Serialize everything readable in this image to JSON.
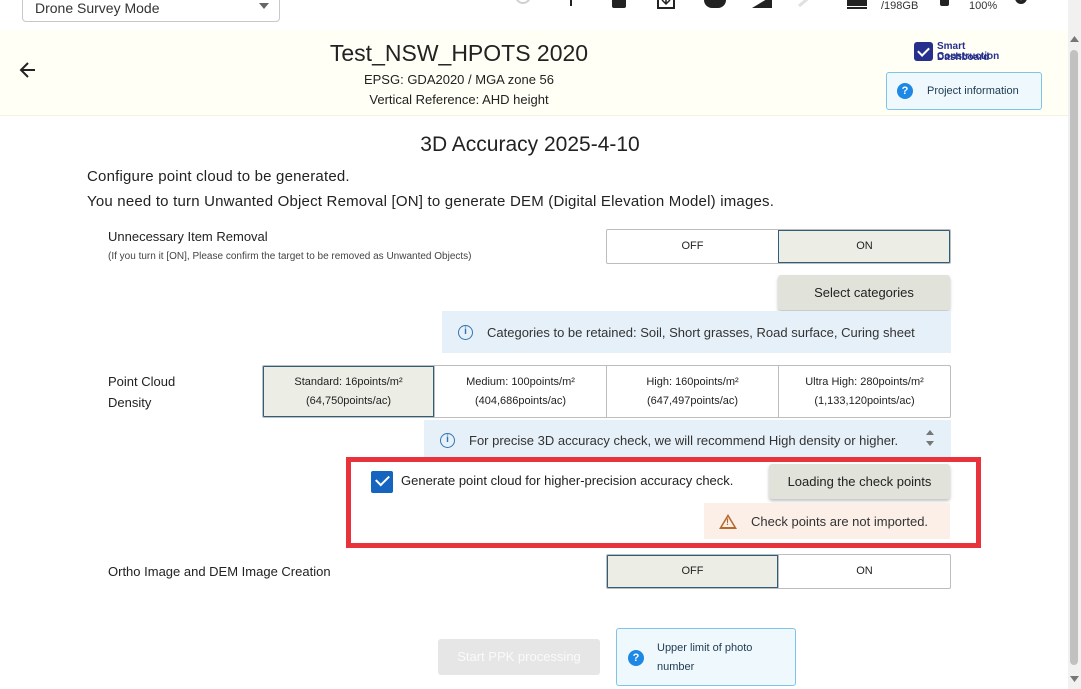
{
  "toolbar": {
    "mode_select": "Drone Survey Mode",
    "storage": "/198GB",
    "zoom": "100%"
  },
  "header": {
    "project_title": "Test_NSW_HPOTS 2020",
    "epsg": "EPSG: GDA2020 / MGA zone 56",
    "vertical_reference": "Vertical Reference: AHD height",
    "logo_line1": "Smart Construction",
    "logo_line2": "Dashboard",
    "project_info_label": "Project information"
  },
  "main": {
    "title": "3D Accuracy 2025-4-10",
    "intro_line1": "Configure point cloud to be generated.",
    "intro_line2": "You need to turn Unwanted Object Removal [ON] to generate DEM (Digital Elevation Model) images.",
    "removal": {
      "label": "Unnecessary Item Removal",
      "note": "(If you turn it [ON], Please confirm the target to be removed as Unwanted Objects)",
      "options": [
        "OFF",
        "ON"
      ],
      "selected": "ON",
      "select_categories_label": "Select categories",
      "categories_info": "Categories to be retained: Soil, Short grasses, Road surface, Curing sheet"
    },
    "density": {
      "label_line1": "Point Cloud",
      "label_line2": "Density",
      "options": [
        {
          "line1": "Standard: 16points/m²",
          "line2": "(64,750points/ac)"
        },
        {
          "line1": "Medium: 100points/m²",
          "line2": "(404,686points/ac)"
        },
        {
          "line1": "High: 160points/m²",
          "line2": "(647,497points/ac)"
        },
        {
          "line1": "Ultra High: 280points/m²",
          "line2": "(1,133,120points/ac)"
        }
      ],
      "selected": "Standard: 16points/m²",
      "info": "For precise 3D accuracy check, we will recommend High density or higher."
    },
    "precision": {
      "checkbox_label": "Generate point cloud for higher-precision accuracy check.",
      "checked": true,
      "load_button": "Loading the check points",
      "warning": "Check points are not imported."
    },
    "ortho": {
      "label": "Ortho Image and DEM Image Creation",
      "options": [
        "OFF",
        "ON"
      ],
      "selected": "OFF"
    },
    "start_button": "Start PPK processing",
    "upper_limit_line1": "Upper limit of photo",
    "upper_limit_line2": "number"
  },
  "icons": {
    "question": "?",
    "info": "i"
  },
  "colors": {
    "accent_blue": "#1565c0",
    "highlight_red": "#e8323c",
    "selected_bg": "#ecede4",
    "info_bg": "#e6f0f8",
    "warning_bg": "#fbefe8"
  }
}
